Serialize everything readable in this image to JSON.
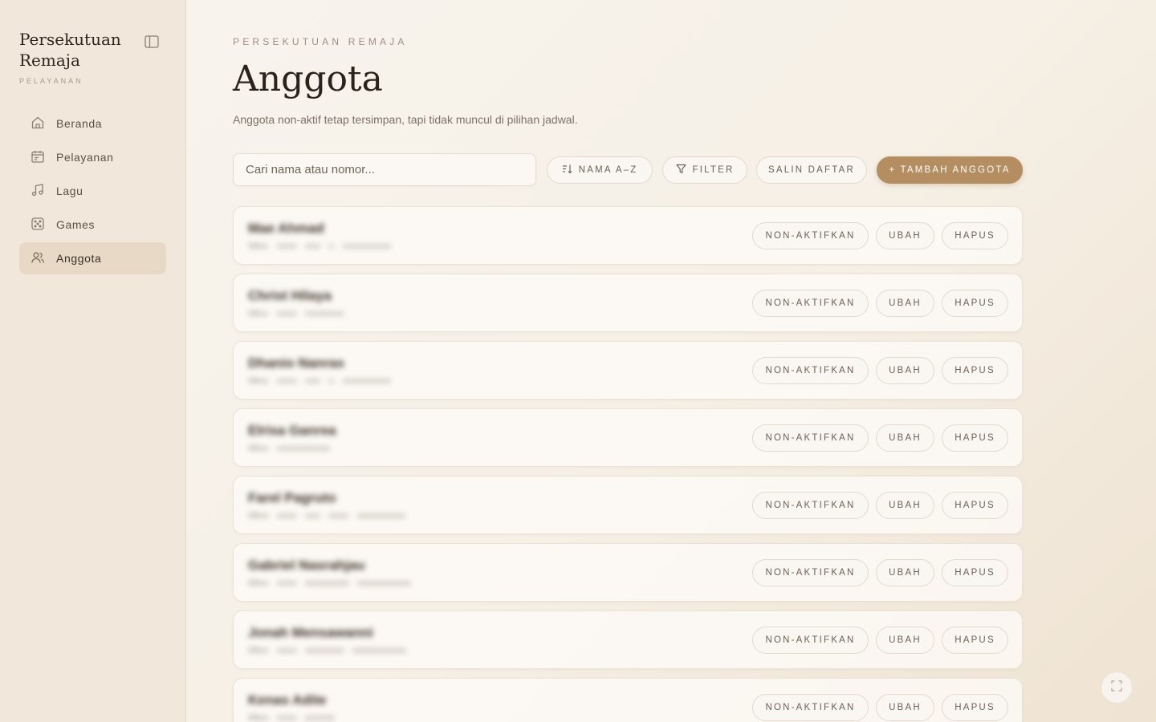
{
  "sidebar": {
    "brand_title": "Persekutuan Remaja",
    "brand_subtitle": "PELAYANAN",
    "items": [
      {
        "label": "Beranda",
        "icon": "home-icon"
      },
      {
        "label": "Pelayanan",
        "icon": "calendar-icon"
      },
      {
        "label": "Lagu",
        "icon": "music-icon"
      },
      {
        "label": "Games",
        "icon": "dice-icon"
      },
      {
        "label": "Anggota",
        "icon": "users-icon",
        "active": true
      }
    ]
  },
  "header": {
    "eyebrow": "PERSEKUTUAN REMAJA",
    "title": "Anggota",
    "subtitle": "Anggota non-aktif tetap tersimpan, tapi tidak muncul di pilihan jadwal."
  },
  "toolbar": {
    "search_placeholder": "Cari nama atau nomor...",
    "sort_label": "NAMA A–Z",
    "filter_label": "FILTER",
    "copy_label": "SALIN DAFTAR",
    "add_label": "+ TAMBAH ANGGOTA"
  },
  "members": [
    {
      "name": "Mae Ahmad",
      "meta": "08xx · xxxx · xxx · x · xxxxxxxxxx",
      "deactivate": "NON-AKTIFKAN",
      "edit": "UBAH",
      "delete": "HAPUS"
    },
    {
      "name": "Christ Hilaya",
      "meta": "08xx · xxxx · xxxxxxxx",
      "deactivate": "NON-AKTIFKAN",
      "edit": "UBAH",
      "delete": "HAPUS"
    },
    {
      "name": "Dhanio Nanras",
      "meta": "08xx · xxxx · xxx · x · xxxxxxxxxx",
      "deactivate": "NON-AKTIFKAN",
      "edit": "UBAH",
      "delete": "HAPUS"
    },
    {
      "name": "Elrisa Ganrea",
      "meta": "08xx · xxxxxxxxxxx",
      "deactivate": "NON-AKTIFKAN",
      "edit": "UBAH",
      "delete": "HAPUS"
    },
    {
      "name": "Farel Pagruto",
      "meta": "08xx · xxxx · xxx · xxxx · xxxxxxxxxx",
      "deactivate": "NON-AKTIFKAN",
      "edit": "UBAH",
      "delete": "HAPUS"
    },
    {
      "name": "Gabriel Nasrahjau",
      "meta": "08xx · xxxx · xxxxxxxxx · xxxxxxxxxxx",
      "deactivate": "NON-AKTIFKAN",
      "edit": "UBAH",
      "delete": "HAPUS"
    },
    {
      "name": "Jonah Mensawanni",
      "meta": "08xx · xxxx · xxxxxxxx · xxxxxxxxxxx",
      "deactivate": "NON-AKTIFKAN",
      "edit": "UBAH",
      "delete": "HAPUS"
    },
    {
      "name": "Kenas Adite",
      "meta": "08xx · xxxx · xxxxxx",
      "deactivate": "NON-AKTIFKAN",
      "edit": "UBAH",
      "delete": "HAPUS"
    }
  ],
  "colors": {
    "accent": "#b48d60",
    "sidebar_bg": "#f1e8db",
    "active_item_bg": "#e8d9c6"
  }
}
